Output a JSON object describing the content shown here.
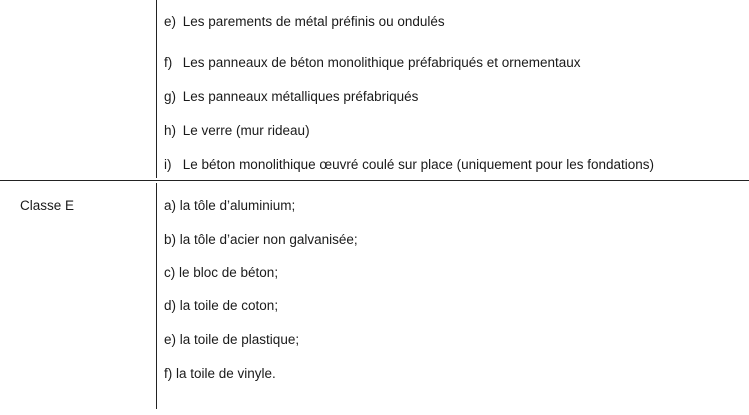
{
  "upper_items": [
    {
      "letter": "e)",
      "text": "Les parements de métal préfinis ou ondulés"
    },
    {
      "letter": "f)",
      "text": "Les panneaux de béton monolithique préfabriqués et ornementaux"
    },
    {
      "letter": "g)",
      "text": "Les panneaux métalliques préfabriqués"
    },
    {
      "letter": "h)",
      "text": "Le verre (mur rideau)"
    },
    {
      "letter": "i)",
      "text": "Le béton monolithique œuvré coulé sur place (uniquement pour les fondations)"
    }
  ],
  "class_label": "Classe E",
  "class_items": [
    "a) la tôle d’aluminium;",
    "b) la tôle d’acier non galvanisée;",
    "c) le bloc de béton;",
    "d) la toile de coton;",
    "e) la toile de plastique;",
    "f) la toile de vinyle."
  ]
}
